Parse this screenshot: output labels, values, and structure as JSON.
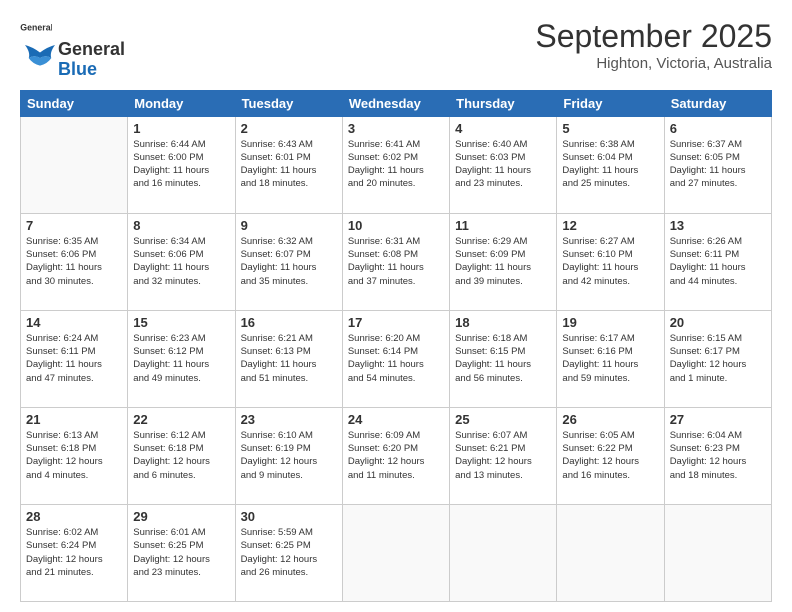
{
  "header": {
    "logo_general": "General",
    "logo_blue": "Blue",
    "month_title": "September 2025",
    "location": "Highton, Victoria, Australia"
  },
  "weekdays": [
    "Sunday",
    "Monday",
    "Tuesday",
    "Wednesday",
    "Thursday",
    "Friday",
    "Saturday"
  ],
  "weeks": [
    [
      {
        "day": "",
        "info": ""
      },
      {
        "day": "1",
        "info": "Sunrise: 6:44 AM\nSunset: 6:00 PM\nDaylight: 11 hours\nand 16 minutes."
      },
      {
        "day": "2",
        "info": "Sunrise: 6:43 AM\nSunset: 6:01 PM\nDaylight: 11 hours\nand 18 minutes."
      },
      {
        "day": "3",
        "info": "Sunrise: 6:41 AM\nSunset: 6:02 PM\nDaylight: 11 hours\nand 20 minutes."
      },
      {
        "day": "4",
        "info": "Sunrise: 6:40 AM\nSunset: 6:03 PM\nDaylight: 11 hours\nand 23 minutes."
      },
      {
        "day": "5",
        "info": "Sunrise: 6:38 AM\nSunset: 6:04 PM\nDaylight: 11 hours\nand 25 minutes."
      },
      {
        "day": "6",
        "info": "Sunrise: 6:37 AM\nSunset: 6:05 PM\nDaylight: 11 hours\nand 27 minutes."
      }
    ],
    [
      {
        "day": "7",
        "info": "Sunrise: 6:35 AM\nSunset: 6:06 PM\nDaylight: 11 hours\nand 30 minutes."
      },
      {
        "day": "8",
        "info": "Sunrise: 6:34 AM\nSunset: 6:06 PM\nDaylight: 11 hours\nand 32 minutes."
      },
      {
        "day": "9",
        "info": "Sunrise: 6:32 AM\nSunset: 6:07 PM\nDaylight: 11 hours\nand 35 minutes."
      },
      {
        "day": "10",
        "info": "Sunrise: 6:31 AM\nSunset: 6:08 PM\nDaylight: 11 hours\nand 37 minutes."
      },
      {
        "day": "11",
        "info": "Sunrise: 6:29 AM\nSunset: 6:09 PM\nDaylight: 11 hours\nand 39 minutes."
      },
      {
        "day": "12",
        "info": "Sunrise: 6:27 AM\nSunset: 6:10 PM\nDaylight: 11 hours\nand 42 minutes."
      },
      {
        "day": "13",
        "info": "Sunrise: 6:26 AM\nSunset: 6:11 PM\nDaylight: 11 hours\nand 44 minutes."
      }
    ],
    [
      {
        "day": "14",
        "info": "Sunrise: 6:24 AM\nSunset: 6:11 PM\nDaylight: 11 hours\nand 47 minutes."
      },
      {
        "day": "15",
        "info": "Sunrise: 6:23 AM\nSunset: 6:12 PM\nDaylight: 11 hours\nand 49 minutes."
      },
      {
        "day": "16",
        "info": "Sunrise: 6:21 AM\nSunset: 6:13 PM\nDaylight: 11 hours\nand 51 minutes."
      },
      {
        "day": "17",
        "info": "Sunrise: 6:20 AM\nSunset: 6:14 PM\nDaylight: 11 hours\nand 54 minutes."
      },
      {
        "day": "18",
        "info": "Sunrise: 6:18 AM\nSunset: 6:15 PM\nDaylight: 11 hours\nand 56 minutes."
      },
      {
        "day": "19",
        "info": "Sunrise: 6:17 AM\nSunset: 6:16 PM\nDaylight: 11 hours\nand 59 minutes."
      },
      {
        "day": "20",
        "info": "Sunrise: 6:15 AM\nSunset: 6:17 PM\nDaylight: 12 hours\nand 1 minute."
      }
    ],
    [
      {
        "day": "21",
        "info": "Sunrise: 6:13 AM\nSunset: 6:18 PM\nDaylight: 12 hours\nand 4 minutes."
      },
      {
        "day": "22",
        "info": "Sunrise: 6:12 AM\nSunset: 6:18 PM\nDaylight: 12 hours\nand 6 minutes."
      },
      {
        "day": "23",
        "info": "Sunrise: 6:10 AM\nSunset: 6:19 PM\nDaylight: 12 hours\nand 9 minutes."
      },
      {
        "day": "24",
        "info": "Sunrise: 6:09 AM\nSunset: 6:20 PM\nDaylight: 12 hours\nand 11 minutes."
      },
      {
        "day": "25",
        "info": "Sunrise: 6:07 AM\nSunset: 6:21 PM\nDaylight: 12 hours\nand 13 minutes."
      },
      {
        "day": "26",
        "info": "Sunrise: 6:05 AM\nSunset: 6:22 PM\nDaylight: 12 hours\nand 16 minutes."
      },
      {
        "day": "27",
        "info": "Sunrise: 6:04 AM\nSunset: 6:23 PM\nDaylight: 12 hours\nand 18 minutes."
      }
    ],
    [
      {
        "day": "28",
        "info": "Sunrise: 6:02 AM\nSunset: 6:24 PM\nDaylight: 12 hours\nand 21 minutes."
      },
      {
        "day": "29",
        "info": "Sunrise: 6:01 AM\nSunset: 6:25 PM\nDaylight: 12 hours\nand 23 minutes."
      },
      {
        "day": "30",
        "info": "Sunrise: 5:59 AM\nSunset: 6:25 PM\nDaylight: 12 hours\nand 26 minutes."
      },
      {
        "day": "",
        "info": ""
      },
      {
        "day": "",
        "info": ""
      },
      {
        "day": "",
        "info": ""
      },
      {
        "day": "",
        "info": ""
      }
    ]
  ]
}
